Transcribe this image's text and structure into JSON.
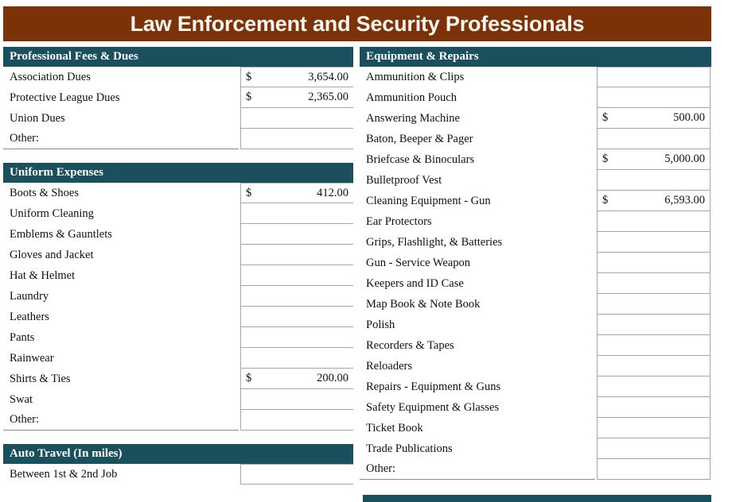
{
  "header": {
    "title": "Law Enforcement and Security Professionals",
    "banner_color": "#7c3209",
    "section_header_color": "#1a4f5e"
  },
  "left_column": {
    "sections": [
      {
        "title": "Professional Fees & Dues",
        "rows": [
          {
            "label": "Association Dues",
            "currency": "$",
            "amount": "3,654.00"
          },
          {
            "label": "Protective League Dues",
            "currency": "$",
            "amount": "2,365.00"
          },
          {
            "label": "Union Dues",
            "currency": "",
            "amount": ""
          },
          {
            "label": "Other:",
            "currency": "",
            "amount": ""
          }
        ]
      },
      {
        "title": "Uniform Expenses",
        "rows": [
          {
            "label": "Boots & Shoes",
            "currency": "$",
            "amount": "412.00"
          },
          {
            "label": "Uniform Cleaning",
            "currency": "",
            "amount": ""
          },
          {
            "label": "Emblems & Gauntlets",
            "currency": "",
            "amount": ""
          },
          {
            "label": "Gloves and Jacket",
            "currency": "",
            "amount": ""
          },
          {
            "label": "Hat & Helmet",
            "currency": "",
            "amount": ""
          },
          {
            "label": "Laundry",
            "currency": "",
            "amount": ""
          },
          {
            "label": "Leathers",
            "currency": "",
            "amount": ""
          },
          {
            "label": "Pants",
            "currency": "",
            "amount": ""
          },
          {
            "label": "Rainwear",
            "currency": "",
            "amount": ""
          },
          {
            "label": "Shirts & Ties",
            "currency": "$",
            "amount": "200.00"
          },
          {
            "label": "Swat",
            "currency": "",
            "amount": ""
          },
          {
            "label": "Other:",
            "currency": "",
            "amount": ""
          }
        ]
      },
      {
        "title": "Auto Travel (In miles)",
        "rows": [
          {
            "label": "Between 1st & 2nd Job",
            "currency": "",
            "amount": ""
          }
        ]
      }
    ]
  },
  "right_column": {
    "sections": [
      {
        "title": "Equipment & Repairs",
        "rows": [
          {
            "label": "Ammunition & Clips",
            "currency": "",
            "amount": ""
          },
          {
            "label": "Ammunition Pouch",
            "currency": "",
            "amount": ""
          },
          {
            "label": "Answering Machine",
            "currency": "$",
            "amount": "500.00"
          },
          {
            "label": "Baton, Beeper & Pager",
            "currency": "",
            "amount": ""
          },
          {
            "label": "Briefcase & Binoculars",
            "currency": "$",
            "amount": "5,000.00"
          },
          {
            "label": "Bulletproof Vest",
            "currency": "",
            "amount": ""
          },
          {
            "label": "Cleaning Equipment - Gun",
            "currency": "$",
            "amount": "6,593.00"
          },
          {
            "label": "Ear Protectors",
            "currency": "",
            "amount": ""
          },
          {
            "label": "Grips, Flashlight, & Batteries",
            "currency": "",
            "amount": ""
          },
          {
            "label": "Gun - Service Weapon",
            "currency": "",
            "amount": ""
          },
          {
            "label": "Keepers and ID Case",
            "currency": "",
            "amount": ""
          },
          {
            "label": "Map Book & Note Book",
            "currency": "",
            "amount": ""
          },
          {
            "label": "Polish",
            "currency": "",
            "amount": ""
          },
          {
            "label": "Recorders & Tapes",
            "currency": "",
            "amount": ""
          },
          {
            "label": "Reloaders",
            "currency": "",
            "amount": ""
          },
          {
            "label": "Repairs - Equipment & Guns",
            "currency": "",
            "amount": ""
          },
          {
            "label": "Safety Equipment & Glasses",
            "currency": "",
            "amount": ""
          },
          {
            "label": "Ticket Book",
            "currency": "",
            "amount": ""
          },
          {
            "label": "Trade Publications",
            "currency": "",
            "amount": ""
          },
          {
            "label": "Other:",
            "currency": "",
            "amount": ""
          }
        ]
      }
    ]
  }
}
